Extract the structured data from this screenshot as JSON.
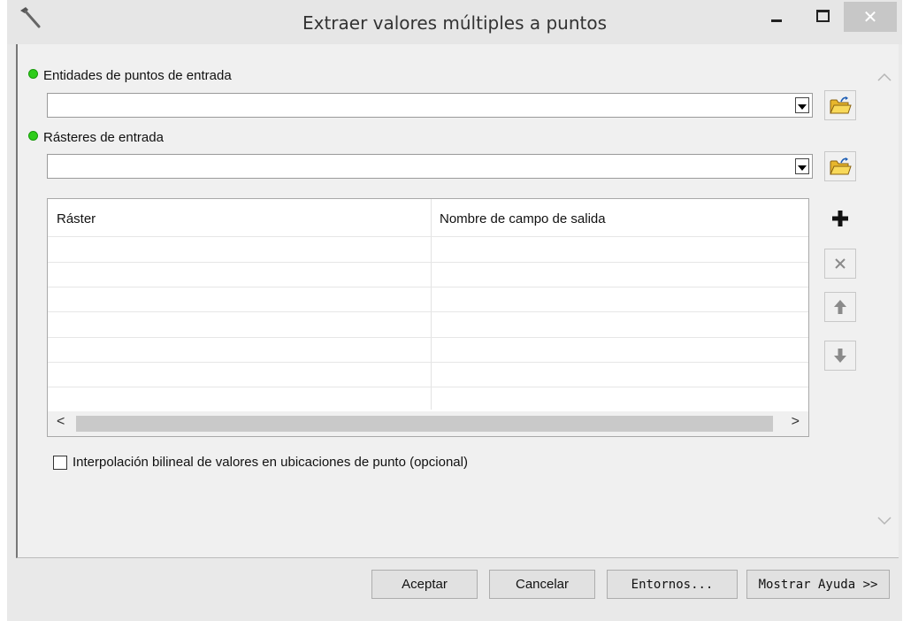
{
  "window": {
    "title": "Extraer valores múltiples a puntos",
    "close_glyph": "✕"
  },
  "form": {
    "point_features": {
      "label": "Entidades de puntos de entrada",
      "value": ""
    },
    "input_rasters": {
      "label": "Rásteres de entrada",
      "value": ""
    },
    "table": {
      "columns": [
        "Ráster",
        "Nombre de campo de salida"
      ],
      "scroll_left": "<",
      "scroll_right": ">"
    },
    "bilinear": {
      "label": "Interpolación bilineal de valores en ubicaciones de punto (opcional)",
      "checked": false
    }
  },
  "buttons": {
    "ok": "Aceptar",
    "cancel": "Cancelar",
    "environments": "Entornos...",
    "show_help": "Mostrar Ayuda >>"
  },
  "icons": {
    "app": "hammer-icon",
    "required": "green-dot-icon",
    "browse": "open-folder-icon",
    "add": "plus-icon",
    "remove": "x-icon",
    "up": "arrow-up-icon",
    "down": "arrow-down-icon"
  },
  "colors": {
    "required_dot": "#2ecc1a",
    "close_button": "#c7c7c7"
  }
}
